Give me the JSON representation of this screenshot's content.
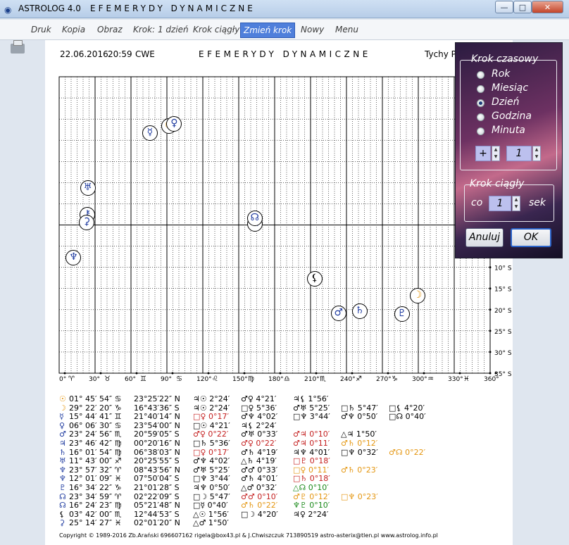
{
  "window": {
    "app_title": "ASTROLOG 4.0",
    "title": "EFEMERYDY DYNAMICZNE",
    "controls": {
      "minimize": "—",
      "maximize": "□",
      "close": "✕"
    }
  },
  "menu": {
    "items": [
      "Druk",
      "Kopia",
      "Obraz",
      "Krok: 1 dzień",
      "Krok ciągły",
      "Zmień krok",
      "Nowy",
      "Menu"
    ]
  },
  "chart_header": {
    "date": "22.06.2016",
    "time": "20:59",
    "zone": "CWE",
    "title": "EFEMERYDY DYNAMICZNE",
    "location": "Tychy P"
  },
  "chart_data": {
    "type": "scatter",
    "title": "EFEMERYDY DYNAMICZNE",
    "x_ticks": [
      {
        "label": "0°",
        "sign": "♈"
      },
      {
        "label": "30°",
        "sign": "♉"
      },
      {
        "label": "60°",
        "sign": "♊"
      },
      {
        "label": "90°",
        "sign": "♋"
      },
      {
        "label": "120°",
        "sign": "♌"
      },
      {
        "label": "150°",
        "sign": "♍"
      },
      {
        "label": "180°",
        "sign": "♎"
      },
      {
        "label": "210°",
        "sign": "♏"
      },
      {
        "label": "240°",
        "sign": "♐"
      },
      {
        "label": "270°",
        "sign": "♑"
      },
      {
        "label": "300°",
        "sign": "♒"
      },
      {
        "label": "330°",
        "sign": "♓"
      },
      {
        "label": "360°",
        "sign": ""
      }
    ],
    "y_ticks": [
      "10° S",
      "15° S",
      "20° S",
      "25° S",
      "30° S",
      "35° S"
    ],
    "xlim": [
      0,
      360
    ],
    "ylim": [
      35,
      -35
    ],
    "points": [
      {
        "body": "Sun",
        "glyph": "☉",
        "lon": 91.8,
        "dec": 23.4,
        "color": "#e49610"
      },
      {
        "body": "Moon",
        "glyph": "☽",
        "lon": 299.4,
        "dec": -16.7,
        "color": "#e49610"
      },
      {
        "body": "Mercury",
        "glyph": "☿",
        "lon": 75.8,
        "dec": 21.7,
        "color": "#203ca0"
      },
      {
        "body": "Venus",
        "glyph": "♀",
        "lon": 96.1,
        "dec": 23.9,
        "color": "#203ca0"
      },
      {
        "body": "Mars",
        "glyph": "♂",
        "lon": 233.4,
        "dec": -20.9,
        "color": "#203ca0"
      },
      {
        "body": "Jupiter",
        "glyph": "♃",
        "lon": 163.8,
        "dec": 0.3,
        "color": "#203ca0"
      },
      {
        "body": "Saturn",
        "glyph": "♄",
        "lon": 251.0,
        "dec": -20.3,
        "color": "#203ca0"
      },
      {
        "body": "Uranus",
        "glyph": "♅",
        "lon": 23.9,
        "dec": 8.7,
        "color": "#203ca0"
      },
      {
        "body": "Neptune",
        "glyph": "♆",
        "lon": 12.0,
        "dec": -7.8,
        "color": "#203ca0"
      },
      {
        "body": "Pluto",
        "glyph": "♇",
        "lon": 286.3,
        "dec": -21.0,
        "color": "#203ca0"
      },
      {
        "body": "Chiron",
        "glyph": "⚷",
        "lon": 23.6,
        "dec": 2.4,
        "color": "#203ca0"
      },
      {
        "body": "Lilith",
        "glyph": "⚸",
        "lon": 213.4,
        "dec": -12.7,
        "color": "#000000"
      },
      {
        "body": "Node",
        "glyph": "☊",
        "lon": 163.4,
        "dec": 1.5,
        "color": "#203ca0"
      },
      {
        "body": "Ceres",
        "glyph": "⚳",
        "lon": 23.0,
        "dec": 0.5,
        "color": "#203ca0"
      }
    ]
  },
  "aspect_table": {
    "rows": [
      {
        "glyph": "☉",
        "glyph_color": "#e49610",
        "pos": "01° 45′ 54″ ♋",
        "dec": "23°25′22″ N",
        "asp": [
          {
            "t": "♃☉ 2°24′",
            "c": "#000"
          },
          {
            "t": "♂♀ 4°21′",
            "c": "#000"
          },
          {
            "t": "♃⚸ 1°56′",
            "c": "#000"
          }
        ]
      },
      {
        "glyph": "☽",
        "glyph_color": "#e49610",
        "pos": "29° 22′ 20″ ♑",
        "dec": "16°43′36″ S",
        "asp": [
          {
            "t": "♃☉ 2°24′",
            "c": "#000"
          },
          {
            "t": "□♀ 5°36′",
            "c": "#000"
          },
          {
            "t": "♂♅ 5°25′",
            "c": "#000"
          },
          {
            "t": "□♄ 5°47′",
            "c": "#000"
          },
          {
            "t": "□⚸ 4°20′",
            "c": "#000"
          }
        ]
      },
      {
        "glyph": "☿",
        "glyph_color": "#203ca0",
        "pos": "15° 44′ 41″ ♊",
        "dec": "21°40′14″ N",
        "asp": [
          {
            "t": "□♀ 0°17′",
            "c": "#c41e1e"
          },
          {
            "t": "♂♆ 4°02′",
            "c": "#000"
          },
          {
            "t": "□♆ 3°44′",
            "c": "#000"
          },
          {
            "t": "♂♆ 0°50′",
            "c": "#000"
          },
          {
            "t": "□☊ 0°40′",
            "c": "#000"
          }
        ]
      },
      {
        "glyph": "♀",
        "glyph_color": "#203ca0",
        "pos": "06° 06′ 30″ ♋",
        "dec": "23°54′00″ N",
        "asp": [
          {
            "t": "□☉ 4°21′",
            "c": "#000"
          },
          {
            "t": "♃⚸ 2°24′",
            "c": "#000"
          }
        ]
      },
      {
        "glyph": "♂",
        "glyph_color": "#203ca0",
        "pos": "23° 24′ 56″ ♏",
        "dec": "20°59′05″ S",
        "asp": [
          {
            "t": "♂♀ 0°22′",
            "c": "#c41e1e"
          },
          {
            "t": "♂♅ 0°33′",
            "c": "#000"
          },
          {
            "t": "♂♃ 0°10′",
            "c": "#c41e1e"
          },
          {
            "t": "△♃ 1°50′",
            "c": "#000"
          }
        ]
      },
      {
        "glyph": "♃",
        "glyph_color": "#203ca0",
        "pos": "23° 46′ 42″ ♍",
        "dec": "00°20′16″ N",
        "asp": [
          {
            "t": "□♄ 5°36′",
            "c": "#000"
          },
          {
            "t": "♂♀ 0°22′",
            "c": "#c41e1e"
          },
          {
            "t": "♂♃ 0°11′",
            "c": "#c41e1e"
          },
          {
            "t": "♂♄ 0°12′",
            "c": "#e49610"
          }
        ]
      },
      {
        "glyph": "♄",
        "glyph_color": "#203ca0",
        "pos": "16° 01′ 54″ ♍",
        "dec": "06°38′03″ N",
        "asp": [
          {
            "t": "□♀ 0°17′",
            "c": "#c41e1e"
          },
          {
            "t": "♂♄ 4°19′",
            "c": "#000"
          },
          {
            "t": "♃♆ 4°01′",
            "c": "#000"
          },
          {
            "t": "□♆ 0°32′",
            "c": "#000"
          },
          {
            "t": "♂☊ 0°22′",
            "c": "#e49610"
          }
        ]
      },
      {
        "glyph": "♅",
        "glyph_color": "#203ca0",
        "pos": "11° 43′ 00″ ♐",
        "dec": "20°25′55″ S",
        "asp": [
          {
            "t": "♂♆ 4°02′",
            "c": "#000"
          },
          {
            "t": "△♄ 4°19′",
            "c": "#000"
          },
          {
            "t": "□♇ 0°18′",
            "c": "#c41e1e"
          }
        ]
      },
      {
        "glyph": "♆",
        "glyph_color": "#203ca0",
        "pos": "23° 57′ 32″ ♈",
        "dec": "08°43′56″ N",
        "asp": [
          {
            "t": "♂♅ 5°25′",
            "c": "#000"
          },
          {
            "t": "♂♂ 0°33′",
            "c": "#000"
          },
          {
            "t": "□♀ 0°11′",
            "c": "#e49610"
          },
          {
            "t": "♂♄ 0°23′",
            "c": "#e49610"
          }
        ]
      },
      {
        "glyph": "♆",
        "glyph_color": "#203ca0",
        "pos": "12° 01′ 09″ ♓",
        "dec": "07°50′04″ S",
        "asp": [
          {
            "t": "□♆ 3°44′",
            "c": "#000"
          },
          {
            "t": "♂♄ 4°01′",
            "c": "#000"
          },
          {
            "t": "□♄ 0°18′",
            "c": "#c41e1e"
          }
        ]
      },
      {
        "glyph": "♇",
        "glyph_color": "#203ca0",
        "pos": "16° 34′ 22″ ♑",
        "dec": "21°01′28″ S",
        "asp": [
          {
            "t": "♃♆ 0°50′",
            "c": "#000"
          },
          {
            "t": "△♂ 0°32′",
            "c": "#000"
          },
          {
            "t": "△☊ 0°10′",
            "c": "#1a8a1a"
          }
        ]
      },
      {
        "glyph": "☊",
        "glyph_color": "#203ca0",
        "pos": "23° 34′ 59″ ♈",
        "dec": "02°22′09″ S",
        "asp": [
          {
            "t": "□☽ 5°47′",
            "c": "#000"
          },
          {
            "t": "♂♂ 0°10′",
            "c": "#c41e1e"
          },
          {
            "t": "♂♇ 0°12′",
            "c": "#e49610"
          },
          {
            "t": "□♆ 0°23′",
            "c": "#e49610"
          }
        ]
      },
      {
        "glyph": "☊",
        "glyph_color": "#203ca0",
        "pos": "16° 24′ 23″ ♍",
        "dec": "05°21′48″ N",
        "asp": [
          {
            "t": "□☿ 0°40′",
            "c": "#000"
          },
          {
            "t": "♂♄ 0°22′",
            "c": "#e49610"
          },
          {
            "t": "♆♇ 0°10′",
            "c": "#1a8a1a"
          }
        ]
      },
      {
        "glyph": "⚸",
        "glyph_color": "#000000",
        "pos": "03° 42′ 00″ ♏",
        "dec": "12°44′53″ S",
        "asp": [
          {
            "t": "△☉ 1°56′",
            "c": "#000"
          },
          {
            "t": "□☽ 4°20′",
            "c": "#000"
          },
          {
            "t": "♃♀ 2°24′",
            "c": "#000"
          }
        ]
      },
      {
        "glyph": "⚳",
        "glyph_color": "#203ca0",
        "pos": "25° 14′ 27″ ♓",
        "dec": "02°01′20″ N",
        "asp": [
          {
            "t": "△♂ 1°50′",
            "c": "#000"
          }
        ]
      }
    ]
  },
  "copyright": "Copyright © 1989-2016 Zb.Arański 696607162 rigela@box43.pl & J.Chwiszczuk 713890519 astro-asterix@tlen.pl www.astrolog.info.pl",
  "dialog": {
    "group_step_label": "Krok czasowy",
    "options": [
      "Rok",
      "Miesiąc",
      "Dzień",
      "Godzina",
      "Minuta"
    ],
    "selected": "Dzień",
    "sign_value": "+",
    "step_value": "1",
    "group_cont_label": "Krok ciągły",
    "co_label": "co",
    "cont_value": "1",
    "unit_label": "sek",
    "cancel_label": "Anuluj",
    "ok_label": "OK"
  }
}
